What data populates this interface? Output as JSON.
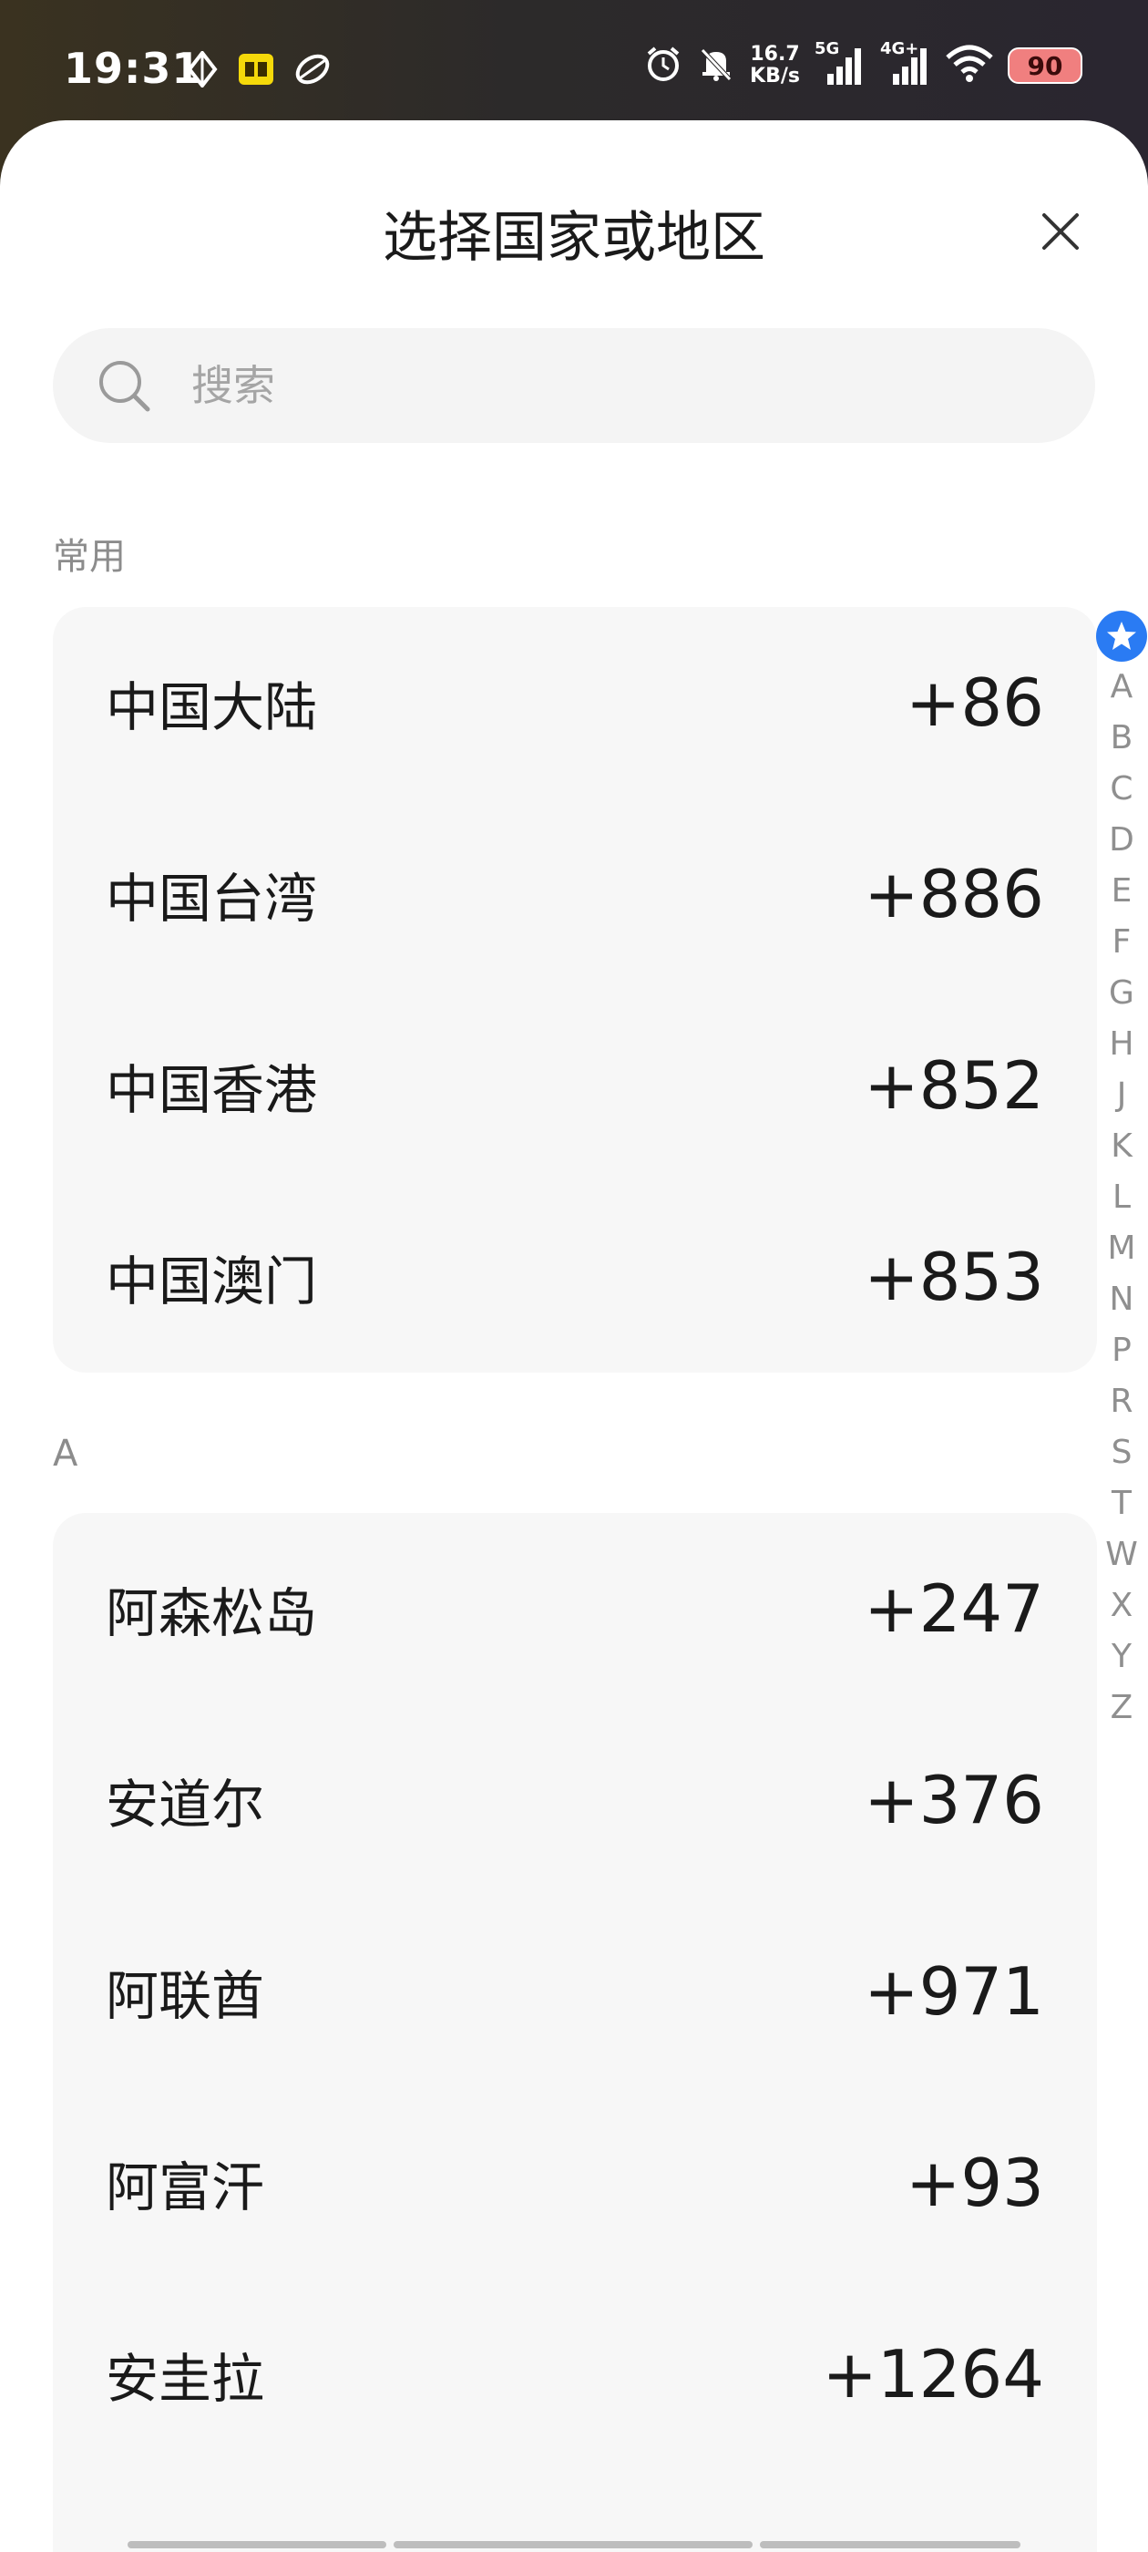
{
  "status_bar": {
    "time": "19:31",
    "net_speed_value": "16.7",
    "net_speed_unit": "KB/s",
    "signal1_tag": "5G",
    "signal2_tag": "4G+",
    "battery": "90"
  },
  "sheet": {
    "title": "选择国家或地区"
  },
  "search": {
    "placeholder": "搜索"
  },
  "sections": [
    {
      "header": "常用",
      "items": [
        {
          "name": "中国大陆",
          "code": "+86"
        },
        {
          "name": "中国台湾",
          "code": "+886"
        },
        {
          "name": "中国香港",
          "code": "+852"
        },
        {
          "name": "中国澳门",
          "code": "+853"
        }
      ]
    },
    {
      "header": "A",
      "items": [
        {
          "name": "阿森松岛",
          "code": "+247"
        },
        {
          "name": "安道尔",
          "code": "+376"
        },
        {
          "name": "阿联酋",
          "code": "+971"
        },
        {
          "name": "阿富汗",
          "code": "+93"
        },
        {
          "name": "安圭拉",
          "code": "+1264"
        }
      ]
    }
  ],
  "index_letters": [
    "A",
    "B",
    "C",
    "D",
    "E",
    "F",
    "G",
    "H",
    "J",
    "K",
    "L",
    "M",
    "N",
    "P",
    "R",
    "S",
    "T",
    "W",
    "X",
    "Y",
    "Z"
  ],
  "colors": {
    "accent": "#2a7bf3",
    "card_bg": "#f7f7f7",
    "search_bg": "#f4f4f4",
    "battery_bg": "#f07f7f"
  }
}
